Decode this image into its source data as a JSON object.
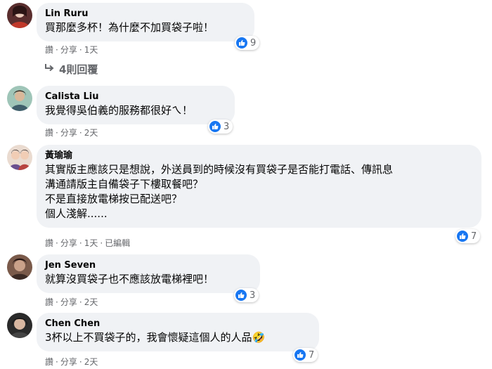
{
  "comments": [
    {
      "author": "Lin Ruru",
      "text": "買那麼多杯！為什麼不加買袋子啦！",
      "reactions": "9",
      "action_like": "讚",
      "action_share": "分享",
      "time": "1天",
      "replies": "4則回覆"
    },
    {
      "author": "Calista Liu",
      "text": "我覺得吳伯義的服務都很好ㄟ！",
      "reactions": "3",
      "action_like": "讚",
      "action_share": "分享",
      "time": "2天"
    },
    {
      "author": "黃瑜瑜",
      "text": "其實版主應該只是想說，外送員到的時候沒有買袋子是否能打電話、傳訊息\n溝通請版主自備袋子下樓取餐吧？\n不是直接放電梯按已配送吧？\n個人淺解......",
      "reactions": "7",
      "action_like": "讚",
      "action_share": "分享",
      "time": "1天",
      "edited": "已編輯"
    },
    {
      "author": "Jen Seven",
      "text": "就算沒買袋子也不應該放電梯裡吧！",
      "reactions": "3",
      "action_like": "讚",
      "action_share": "分享",
      "time": "2天"
    },
    {
      "author": "Chen Chen",
      "text": "3杯以上不買袋子的，我會懷疑這個人的人品🤣",
      "reactions": "7",
      "action_like": "讚",
      "action_share": "分享",
      "time": "2天"
    }
  ],
  "colors": {
    "bubble": "#f0f2f5",
    "like_blue": "#1877f2",
    "meta_gray": "#65676b"
  }
}
